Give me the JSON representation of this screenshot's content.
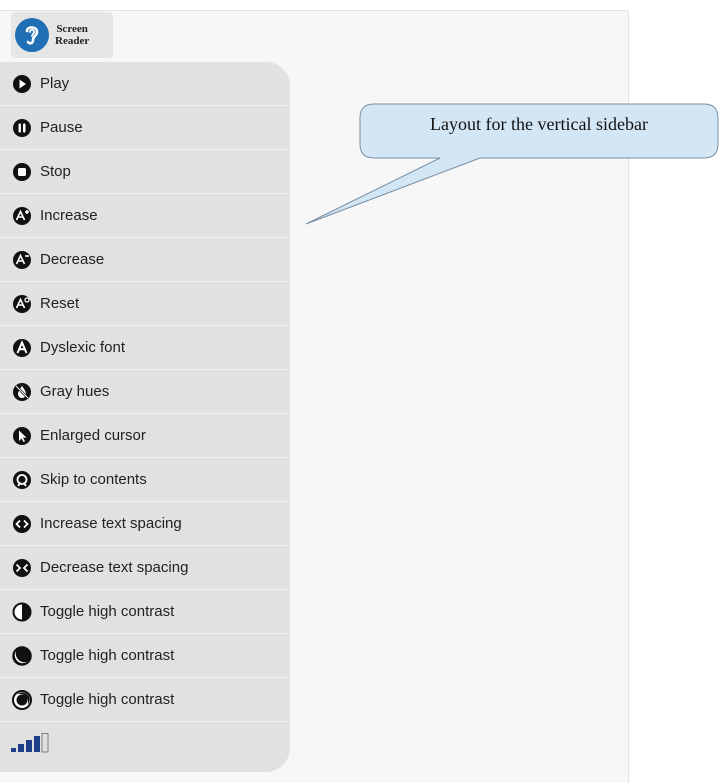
{
  "logo": {
    "line1": "Screen",
    "line2": "Reader",
    "icon": "ear-icon"
  },
  "sidebar": {
    "items": [
      {
        "label": "Play",
        "icon": "play-icon"
      },
      {
        "label": "Pause",
        "icon": "pause-icon"
      },
      {
        "label": "Stop",
        "icon": "stop-icon"
      },
      {
        "label": "Increase",
        "icon": "font-increase-icon"
      },
      {
        "label": "Decrease",
        "icon": "font-decrease-icon"
      },
      {
        "label": "Reset",
        "icon": "font-reset-icon"
      },
      {
        "label": "Dyslexic font",
        "icon": "dyslexic-font-icon"
      },
      {
        "label": "Gray hues",
        "icon": "gray-hues-icon"
      },
      {
        "label": "Enlarged cursor",
        "icon": "cursor-icon"
      },
      {
        "label": "Skip to contents",
        "icon": "skip-icon"
      },
      {
        "label": "Increase text spacing",
        "icon": "spacing-increase-icon"
      },
      {
        "label": "Decrease text spacing",
        "icon": "spacing-decrease-icon"
      },
      {
        "label": "Toggle high contrast",
        "icon": "contrast-half-icon"
      },
      {
        "label": "Toggle high contrast",
        "icon": "contrast-dark-icon"
      },
      {
        "label": "Toggle high contrast",
        "icon": "contrast-light-icon"
      }
    ],
    "volume": {
      "icon": "volume-icon",
      "level": 0.75
    }
  },
  "callout": {
    "text": "Layout for the vertical sidebar"
  }
}
